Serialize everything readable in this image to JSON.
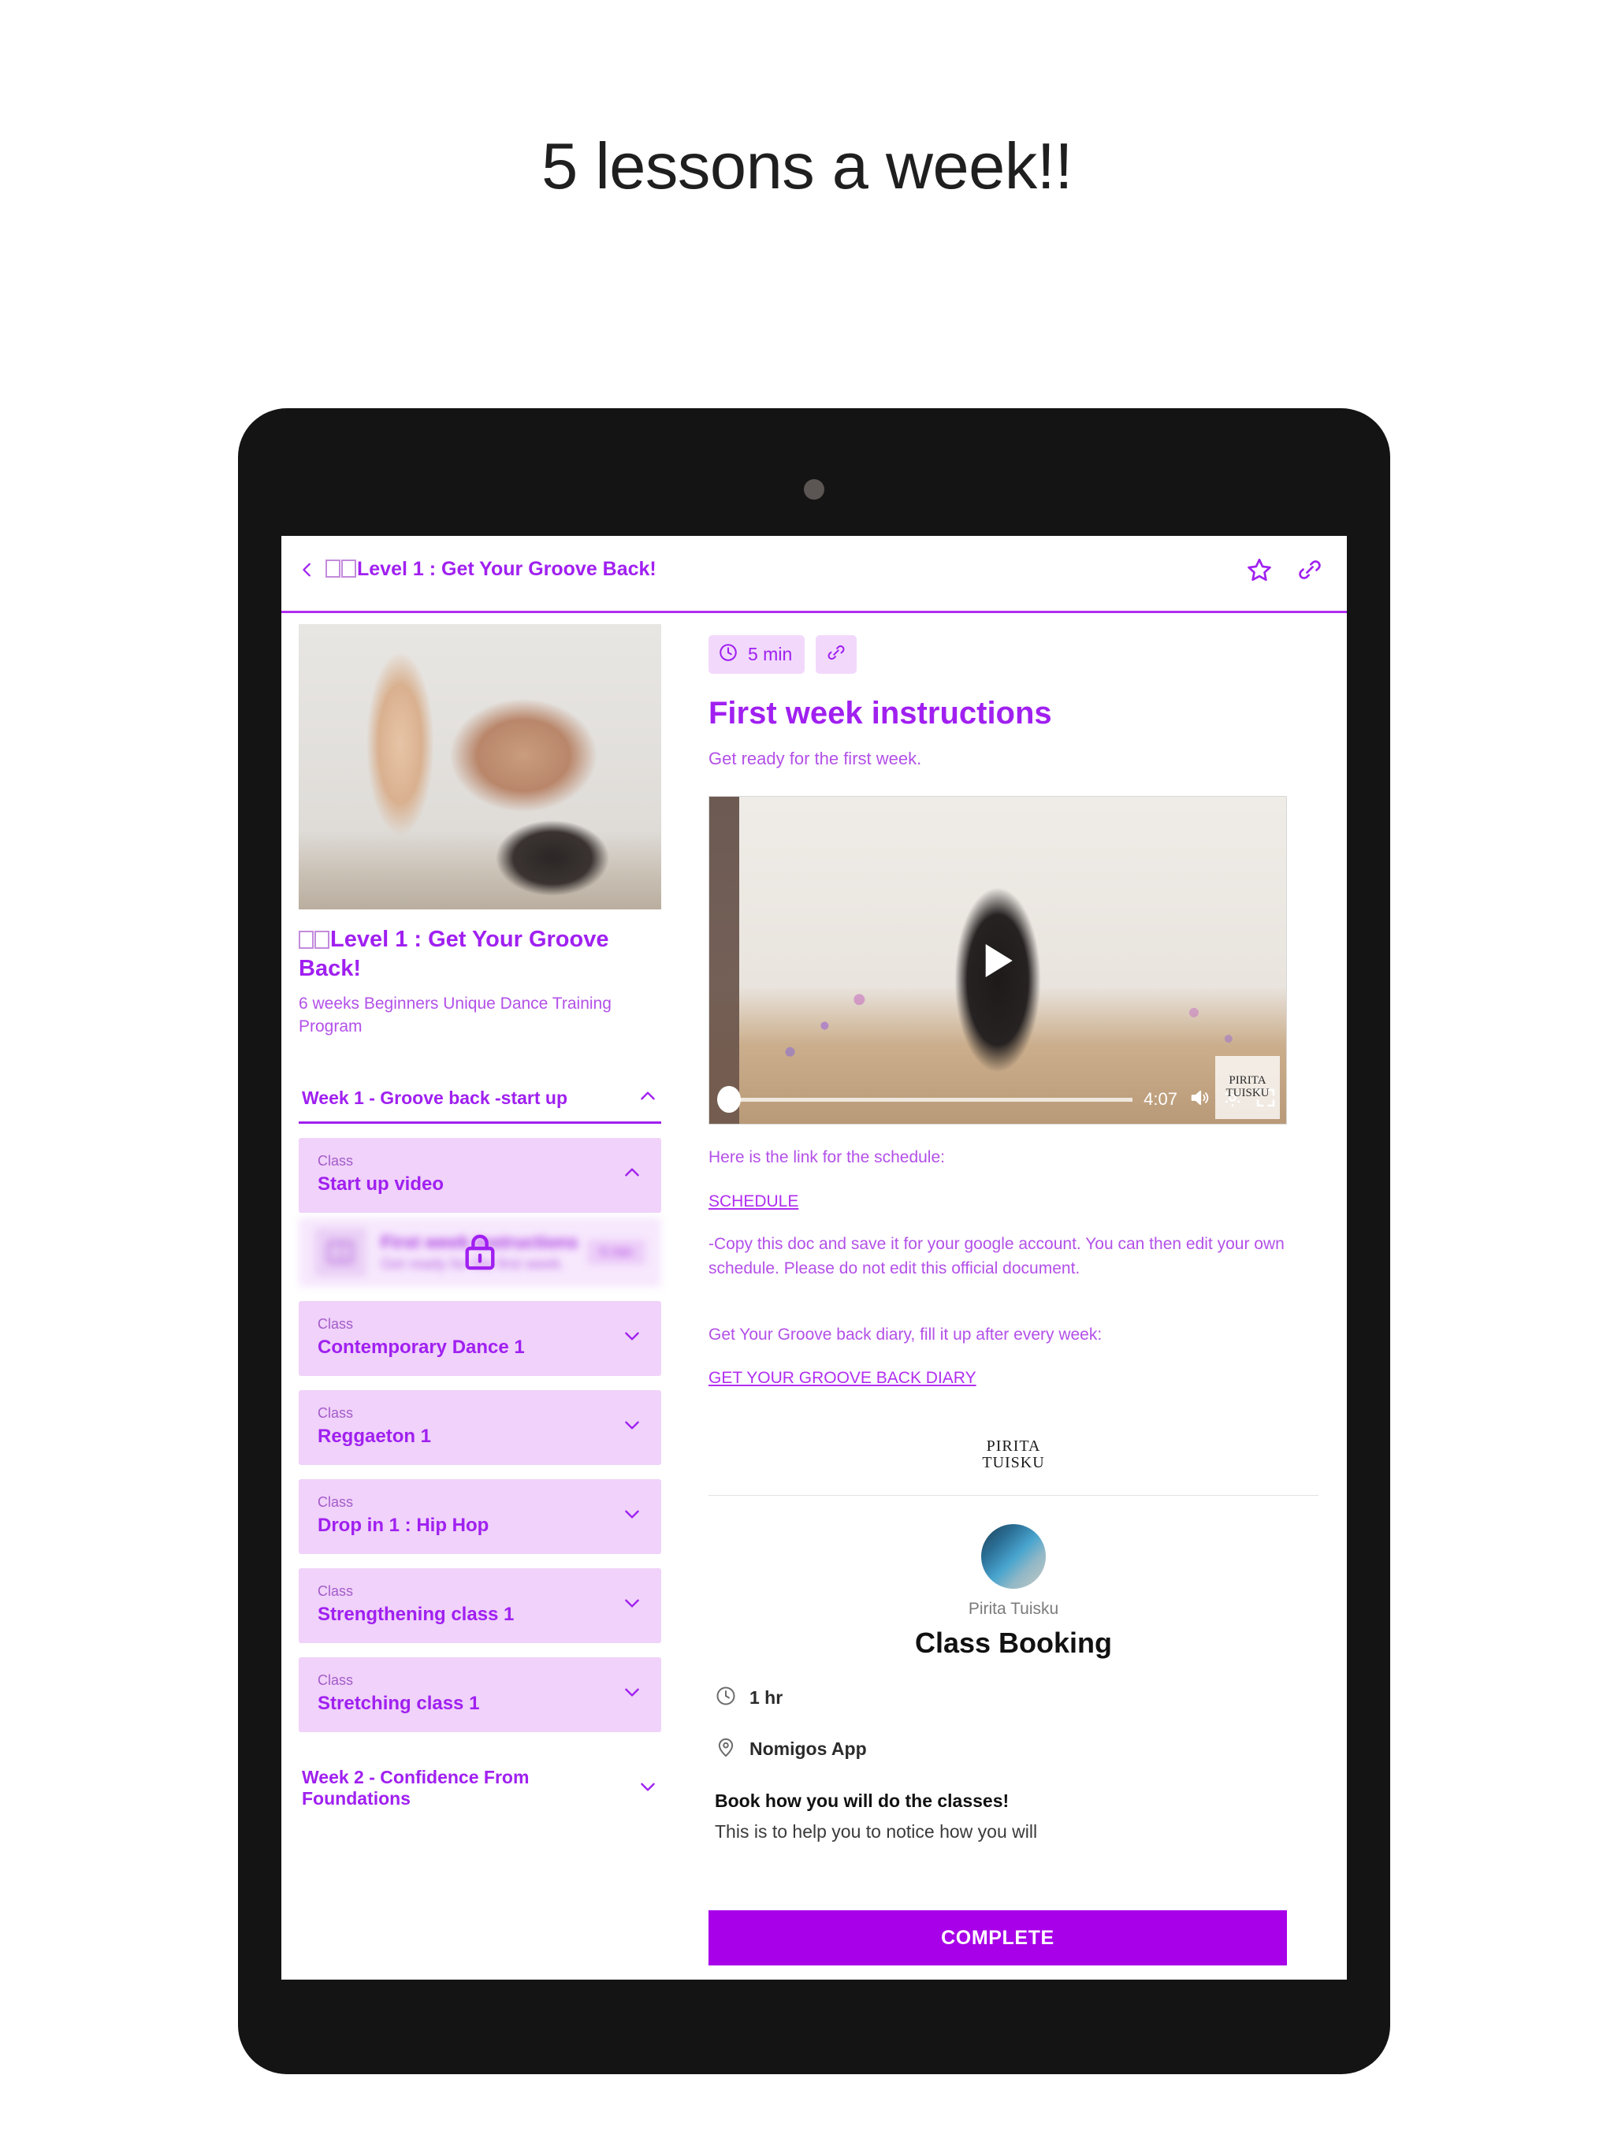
{
  "headline": "5 lessons a week!!",
  "appbar": {
    "back_icon": "chevron-left-icon",
    "title": "Level 1 : Get Your Groove Back!",
    "star_icon": "star-icon",
    "link_icon": "link-icon"
  },
  "course": {
    "title": "Level 1 : Get Your Groove Back!",
    "subtitle": "6 weeks Beginners Unique Dance Training Program",
    "hero_alt": "woman-raising-fist-photo"
  },
  "sections": [
    {
      "label": "Week 1 - Groove back -start up",
      "expanded": true,
      "chevron": "chevron-up-icon"
    },
    {
      "label": "Week 2 - Confidence From Foundations",
      "expanded": false,
      "chevron": "chevron-down-icon"
    }
  ],
  "classes": [
    {
      "kicker": "Class",
      "name": "Start up video",
      "chevron": "chevron-up-icon",
      "expanded": true
    },
    {
      "kicker": "Class",
      "name": "Contemporary Dance 1",
      "chevron": "chevron-down-icon",
      "expanded": false
    },
    {
      "kicker": "Class",
      "name": "Reggaeton 1",
      "chevron": "chevron-down-icon",
      "expanded": false
    },
    {
      "kicker": "Class",
      "name": "Drop in 1 : Hip Hop",
      "chevron": "chevron-down-icon",
      "expanded": false
    },
    {
      "kicker": "Class",
      "name": "Strengthening class 1",
      "chevron": "chevron-down-icon",
      "expanded": false
    },
    {
      "kicker": "Class",
      "name": "Stretching class 1",
      "chevron": "chevron-down-icon",
      "expanded": false
    }
  ],
  "locked_lesson": {
    "title": "First week instructions",
    "subtitle": "Get ready for the first week.",
    "badge": "5 min",
    "lock_icon": "lock-icon",
    "thumb_icon": "book-icon"
  },
  "lesson": {
    "duration_chip": "5 min",
    "clock_icon": "clock-icon",
    "link_icon": "link-icon",
    "title": "First week instructions",
    "subtitle": "Get ready for the first week."
  },
  "video": {
    "play_icon": "play-icon",
    "duration": "4:07",
    "volume_icon": "volume-icon",
    "settings_icon": "gear-icon",
    "fullscreen_icon": "fullscreen-icon",
    "watermark_line1": "PIRITA",
    "watermark_line2": "TUISKU"
  },
  "content": {
    "schedule_intro": "Here is the link for the schedule:",
    "schedule_link": "SCHEDULE",
    "schedule_note": "-Copy this doc and save it for your google account. You can then edit your own schedule. Please do not edit this official document.",
    "diary_intro": "Get Your Groove back diary, fill it up after every week:",
    "diary_link": "GET YOUR GROOVE BACK DIARY"
  },
  "brand": {
    "line1": "PIRITA",
    "line2": "TUISKU"
  },
  "booking": {
    "avatar_alt": "pirita-tuisku-avatar",
    "host": "Pirita Tuisku",
    "title": "Class Booking",
    "duration": "1 hr",
    "duration_icon": "clock-icon",
    "location": "Nomigos App",
    "location_icon": "map-pin-icon",
    "heading": "Book how you will do the classes!",
    "body_cut": "This is to help you to notice how you will"
  },
  "complete_button": "COMPLETE",
  "colors": {
    "accent": "#a020f0",
    "accent_button": "#a800e8",
    "card_bg": "#f0d2fa",
    "chip_bg": "#f2d9fc",
    "bezel": "#141414"
  }
}
